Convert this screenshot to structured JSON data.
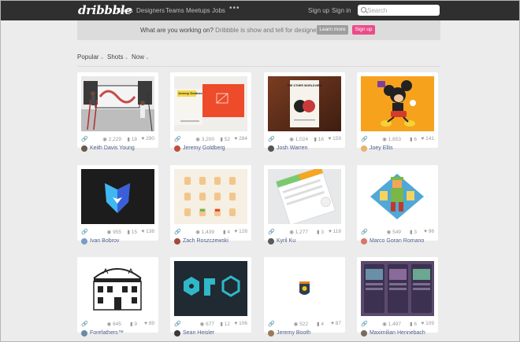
{
  "nav": {
    "logo": "dribbble",
    "items": [
      "Shots",
      "Designers",
      "Teams",
      "Meetups",
      "Jobs"
    ],
    "more": "•••",
    "signup": "Sign up",
    "signin": "Sign in",
    "search_placeholder": "Search"
  },
  "banner": {
    "question": "What are you working on?",
    "tagline": "Dribbble is show and tell for designers.",
    "learn_more": "Learn more",
    "sign_up": "Sign up"
  },
  "filters": {
    "popular": "Popular",
    "shots": "Shots",
    "now": "Now",
    "chevron": "⌄"
  },
  "stat_icons": {
    "views": "eye-icon",
    "comments": "comment-icon",
    "likes": "heart-icon",
    "link": "link-icon"
  },
  "shots": [
    {
      "views": "2,229",
      "comments": "18",
      "likes": "290",
      "author": "Keith Davis Young"
    },
    {
      "views": "3,200",
      "comments": "52",
      "likes": "284",
      "author": "Jeremy Goldberg"
    },
    {
      "views": "1,024",
      "comments": "16",
      "likes": "159",
      "author": "Josh Warren"
    },
    {
      "views": "1,653",
      "comments": "6",
      "likes": "141",
      "author": "Joey Ellis"
    },
    {
      "views": "955",
      "comments": "15",
      "likes": "138",
      "author": "Ivan Bobrov"
    },
    {
      "views": "1,439",
      "comments": "4",
      "likes": "128",
      "author": "Zach Roszczewski"
    },
    {
      "views": "1,277",
      "comments": "3",
      "likes": "118",
      "author": "Kyril Ku"
    },
    {
      "views": "549",
      "comments": "3",
      "likes": "96",
      "author": "Marco Goran Romano"
    },
    {
      "views": "645",
      "comments": "9",
      "likes": "89",
      "author": "Forefathers™"
    },
    {
      "views": "677",
      "comments": "12",
      "likes": "106",
      "author": "Sean Heisler"
    },
    {
      "views": "522",
      "comments": "4",
      "likes": "87",
      "author": "Jeremy Booth"
    },
    {
      "views": "1,497",
      "comments": "6",
      "likes": "109",
      "author": "Maximilian Hennebach"
    }
  ],
  "thumb_texts": {
    "goldberg_label": "Jeremy Goldberg",
    "book_title": "THE OTHER WORLDVIEW"
  },
  "colors": {
    "accent": "#ea4c89",
    "nav_bg": "#2f2f2f",
    "link": "#4a5d8c"
  }
}
